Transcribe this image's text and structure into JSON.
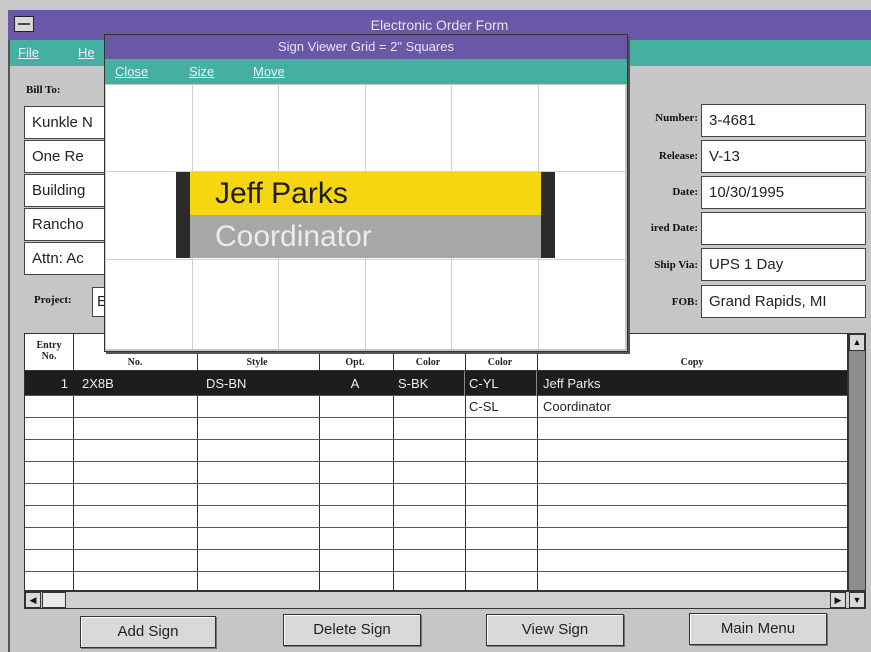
{
  "window": {
    "title": "Electronic Order Form"
  },
  "menu": {
    "file": "File",
    "help": "He"
  },
  "bill_to": {
    "label": "Bill To:",
    "lines": [
      "Kunkle N",
      "One Re",
      "Building",
      "Rancho",
      "Attn: Ac"
    ]
  },
  "order": {
    "number_label": "Number:",
    "number": "3-4681",
    "release_label": "Release:",
    "release": "V-13",
    "date_label": "Date:",
    "date": "10/30/1995",
    "required_date_label": "ired Date:",
    "required_date": "",
    "ship_via_label": "Ship Via:",
    "ship_via": "UPS 1 Day",
    "fob_label": "FOB:",
    "fob": "Grand Rapids, MI"
  },
  "project": {
    "label": "Project:",
    "value": "E"
  },
  "viewer": {
    "title": "Sign Viewer Grid = 2\" Squares",
    "menu": {
      "close": "Close",
      "size": "Size",
      "move": "Move"
    },
    "sign": {
      "line1": "Jeff Parks",
      "line1_bg": "#f6d511",
      "line2": "Coordinator",
      "line2_bg": "#a7a7a7",
      "frame_color": "#2b2b2b"
    }
  },
  "table": {
    "headers": {
      "entry_l1": "Entry",
      "entry_l2": "No.",
      "no": "No.",
      "style": "Style",
      "opt": "Opt.",
      "color1": "Color",
      "color2": "Color",
      "copy": "Copy"
    },
    "rows": [
      {
        "entry": "1",
        "no": "2X8B",
        "style": "DS-BN",
        "opt": "A",
        "color1": "S-BK",
        "color2": "C-YL",
        "copy": "Jeff Parks"
      },
      {
        "entry": "",
        "no": "",
        "style": "",
        "opt": "",
        "color1": "",
        "color2": "C-SL",
        "copy": "Coordinator"
      }
    ]
  },
  "buttons": {
    "add": "Add Sign",
    "delete": "Delete Sign",
    "view": "View Sign",
    "main": "Main Menu"
  },
  "colors": {
    "titlebar": "#6a58a6",
    "menubar": "#43b0a2",
    "selection": "#1d1d1d"
  }
}
